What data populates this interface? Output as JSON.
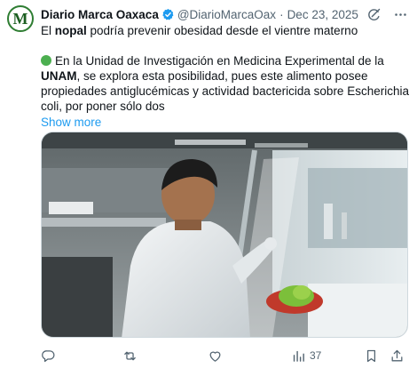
{
  "account": {
    "avatar_letter": "M",
    "name": "Diario Marca Oaxaca",
    "handle": "@DiarioMarcaOax",
    "separator": "·",
    "date": "Dec 23, 2025"
  },
  "post": {
    "line1_pre": "El ",
    "line1_bold": "nopal",
    "line1_post": " podría prevenir obesidad desde el vientre materno",
    "para2_pre": "En la Unidad de Investigación en Medicina Experimental de la ",
    "para2_bold": "UNAM",
    "para2_post": ", se explora esta posibilidad, pues este alimento posee propiedades antiglucémicas y actividad bactericida sobre Escherichia coli, por poner sólo dos",
    "show_more": "Show more"
  },
  "actions": {
    "views_count": "37"
  },
  "colors": {
    "accent": "#1d9bf0",
    "verified": "#1d9bf0",
    "secondary_text": "#536471",
    "avatar_border": "#2e7d32"
  },
  "icons": [
    "verified-badge-icon",
    "grok-icon",
    "more-icon",
    "reply-icon",
    "repost-icon",
    "like-icon",
    "views-icon",
    "bookmark-icon",
    "share-icon"
  ]
}
